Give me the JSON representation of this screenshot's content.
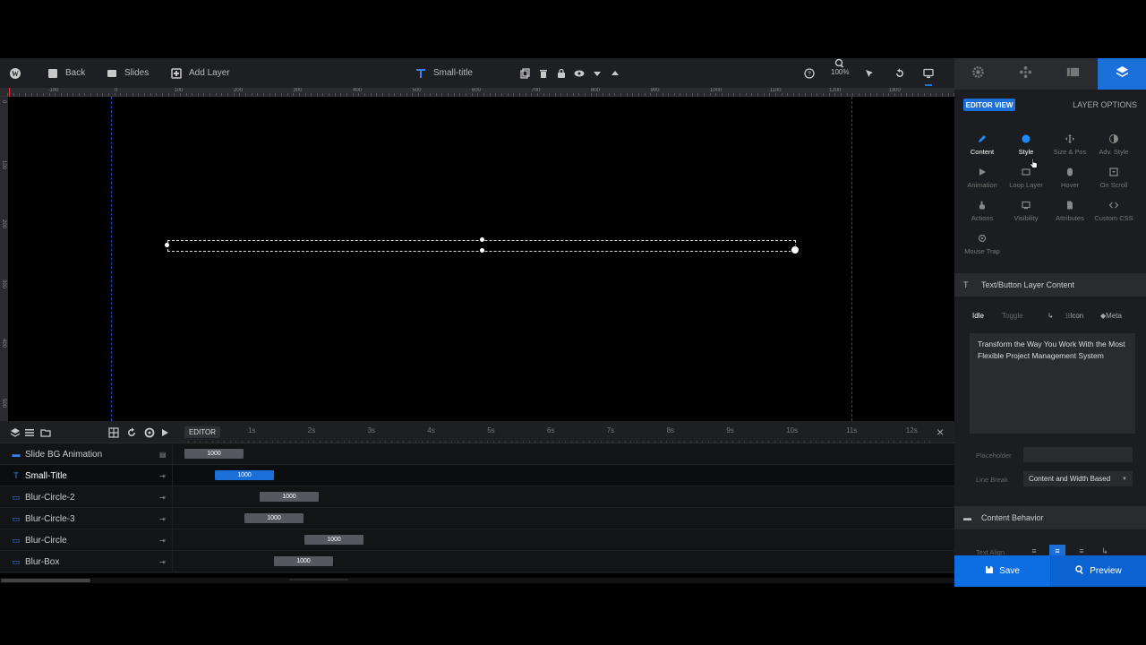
{
  "toolbar": {
    "back": "Back",
    "slides": "Slides",
    "add_layer": "Add Layer",
    "layer_name": "Small-title",
    "zoom": "100%"
  },
  "ruler": {
    "top_labels": [
      "-100",
      "0",
      "100",
      "200",
      "300",
      "400",
      "500",
      "600",
      "700",
      "800",
      "900",
      "1000",
      "1100",
      "1200",
      "1300"
    ],
    "left_labels": [
      "0",
      "100",
      "200",
      "300",
      "400",
      "500"
    ]
  },
  "timeline": {
    "editor_label": "EDITOR",
    "seconds": [
      "1s",
      "2s",
      "3s",
      "4s",
      "5s",
      "6s",
      "7s",
      "8s",
      "9s",
      "10s",
      "11s",
      "12s"
    ],
    "rows": [
      {
        "name": "Slide BG Animation",
        "bar": "1000"
      },
      {
        "name": "Small-Title",
        "bar": "1000"
      },
      {
        "name": "Blur-Circle-2",
        "bar": "1000"
      },
      {
        "name": "Blur-Circle-3",
        "bar": "1000"
      },
      {
        "name": "Blur-Circle",
        "bar": "1000"
      },
      {
        "name": "Blur-Box",
        "bar": "1000"
      }
    ]
  },
  "panel": {
    "editor_view": "EDITOR VIEW",
    "layer_options": "LAYER OPTIONS",
    "options": [
      "Content",
      "Style",
      "Size & Pos",
      "Adv. Style",
      "Animation",
      "Loop Layer",
      "Hover",
      "On Scroll",
      "Actions",
      "Visibility",
      "Attributes",
      "Custom CSS",
      "Mouse Trap"
    ],
    "section_title": "Text/Button Layer Content",
    "subtab_idle": "Idle",
    "subtab_toggle": "Toggle",
    "icon_btn": "Icon",
    "meta_btn": "Meta",
    "content_text": "Transform the Way You Work With the Most Flexible Project Management System",
    "placeholder_label": "Placeholder",
    "line_break_label": "Line Break",
    "line_break_value": "Content and Width Based",
    "behavior_title": "Content Behavior",
    "text_align_label": "Text Align",
    "save": "Save",
    "preview": "Preview"
  },
  "colors": {
    "accent": "#1a6fd8",
    "guide": "#2346c8",
    "background": "#000000"
  }
}
